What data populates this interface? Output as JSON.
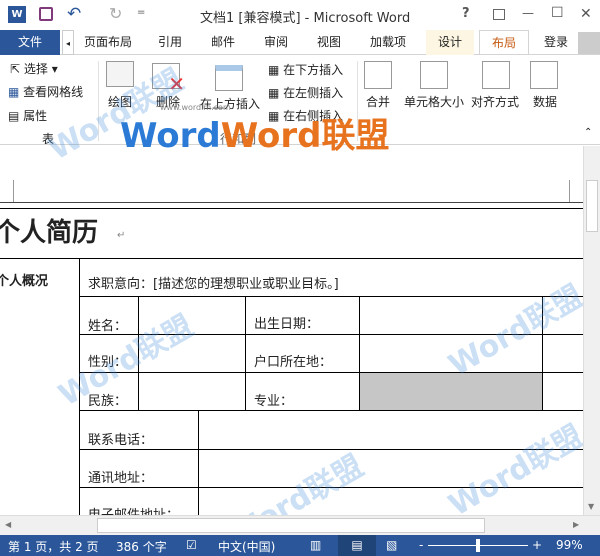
{
  "window": {
    "title": "文档1 [兼容模式] - Microsoft Word",
    "help": "?",
    "minimize": "—",
    "maximize": "☐",
    "close": "✕"
  },
  "quick_access": {
    "undo": "↶",
    "redo": "↻",
    "more": "="
  },
  "tabs": [
    {
      "label": "文件"
    },
    {
      "label": "页面布局"
    },
    {
      "label": "引用"
    },
    {
      "label": "邮件"
    },
    {
      "label": "审阅"
    },
    {
      "label": "视图"
    },
    {
      "label": "加载项"
    },
    {
      "label": "设计"
    },
    {
      "label": "布局",
      "active": true
    },
    {
      "label": "登录"
    }
  ],
  "ribbon": {
    "select": "选择",
    "view_gridlines": "查看网格线",
    "properties": "属性",
    "group_table": "表",
    "draw": "绘图",
    "delete": "删除",
    "insert_above": "在上方插入",
    "insert_below": "在下方插入",
    "insert_left": "在左侧插入",
    "insert_right": "在右侧插入",
    "group_rows_cols": "行和列",
    "merge": "合并",
    "cell_size": "单元格大小",
    "alignment": "对齐方式",
    "data": "数据"
  },
  "document": {
    "heading": "个人简历",
    "section": "个人概况",
    "objective": "求职意向：[描述您的理想职业或职业目标。]",
    "name": "姓名：",
    "birth": "出生日期：",
    "gender": "性别：",
    "hukou": "户口所在地：",
    "ethnic": "民族：",
    "major": "专业：",
    "phone": "联系电话：",
    "address": "通讯地址：",
    "email": "电子邮件地址：",
    "para_mark": "↵"
  },
  "watermark": {
    "brand": "Word联盟",
    "url": "www.wordlm.com"
  },
  "status": {
    "page": "第 1 页，共 2 页",
    "words": "386 个字",
    "language": "中文(中国)",
    "zoom": "99%",
    "zoom_minus": "-",
    "zoom_plus": "+",
    "zoom_level": 0.5
  },
  "colors": {
    "accent": "#2b579a",
    "active_tab_text": "#c55a11",
    "design_tab_bg": "#fdf6e3"
  }
}
